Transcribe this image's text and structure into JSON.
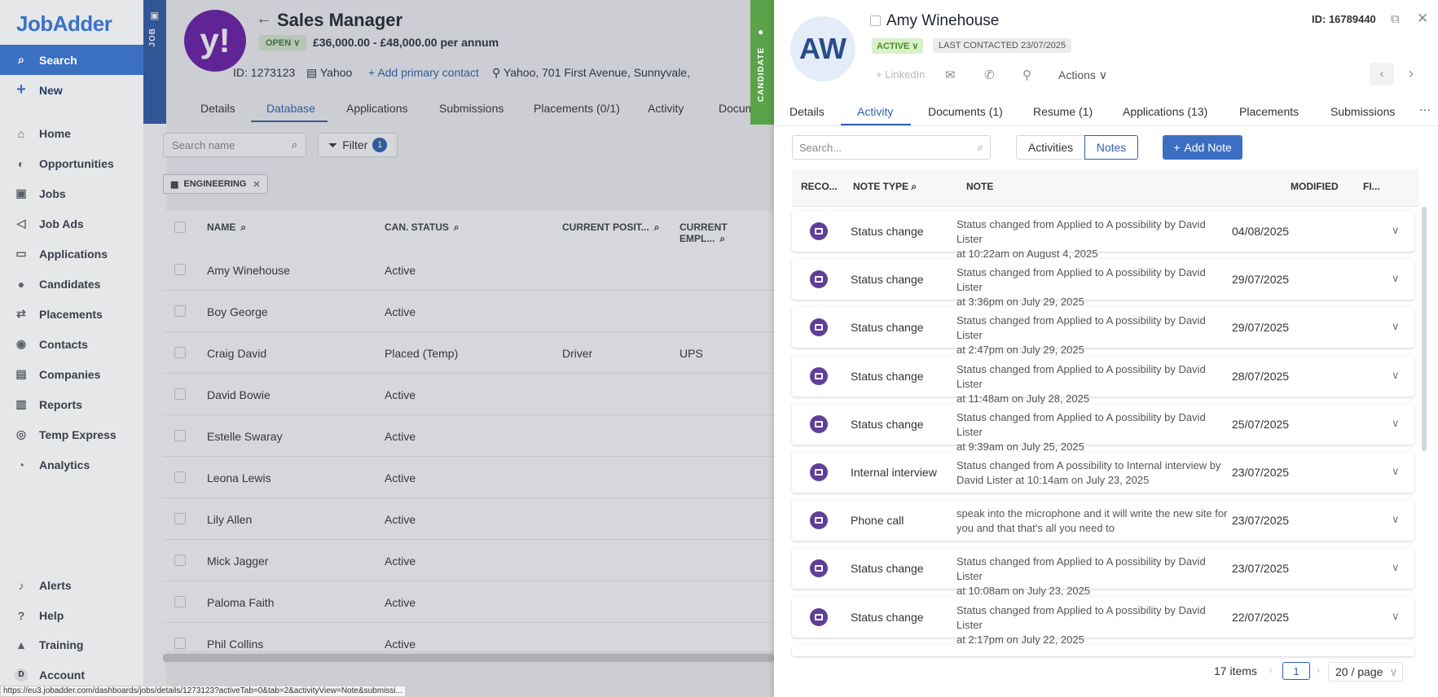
{
  "app": {
    "logo": "JobAdder"
  },
  "sidebar": {
    "items": [
      {
        "label": "Search",
        "icon": "search-icon"
      },
      {
        "label": "New",
        "icon": "plus-icon"
      },
      {
        "label": "Home",
        "icon": "home-icon"
      },
      {
        "label": "Opportunities",
        "icon": "opportunities-icon"
      },
      {
        "label": "Jobs",
        "icon": "briefcase-icon"
      },
      {
        "label": "Job Ads",
        "icon": "megaphone-icon"
      },
      {
        "label": "Applications",
        "icon": "applications-icon"
      },
      {
        "label": "Candidates",
        "icon": "person-icon"
      },
      {
        "label": "Placements",
        "icon": "placements-icon"
      },
      {
        "label": "Contacts",
        "icon": "contacts-icon"
      },
      {
        "label": "Companies",
        "icon": "building-icon"
      },
      {
        "label": "Reports",
        "icon": "reports-icon"
      },
      {
        "label": "Temp Express",
        "icon": "temp-express-icon"
      },
      {
        "label": "Analytics",
        "icon": "pie-chart-icon"
      }
    ],
    "bottom": [
      {
        "label": "Alerts",
        "icon": "bell-icon"
      },
      {
        "label": "Help",
        "icon": "help-icon"
      },
      {
        "label": "Training",
        "icon": "training-icon"
      },
      {
        "label": "Account",
        "icon": "account-icon",
        "avatar": "D"
      }
    ]
  },
  "job": {
    "strip_label": "JOB",
    "logo_text": "y!",
    "title": "Sales Manager",
    "status": "OPEN",
    "salary": "£36,000.00 - £48,000.00 per annum",
    "id": "ID: 1273123",
    "company": "Yahoo",
    "add_contact": "Add primary contact",
    "location": "Yahoo, 701 First Avenue, Sunnyvale,",
    "tabs": [
      "Details",
      "Database",
      "Applications",
      "Submissions",
      "Placements (0/1)",
      "Activity",
      "Docum"
    ],
    "search_placeholder": "Search name",
    "filter_label": "Filter",
    "filter_count": "1",
    "tag": "ENGINEERING",
    "columns": [
      "NAME",
      "CAN. STATUS",
      "CURRENT POSIT...",
      "CURRENT EMPL..."
    ],
    "rows": [
      {
        "name": "Amy Winehouse",
        "status": "Active",
        "position": "",
        "employer": ""
      },
      {
        "name": "Boy George",
        "status": "Active",
        "position": "",
        "employer": ""
      },
      {
        "name": "Craig David",
        "status": "Placed (Temp)",
        "position": "Driver",
        "employer": "UPS"
      },
      {
        "name": "David Bowie",
        "status": "Active",
        "position": "",
        "employer": ""
      },
      {
        "name": "Estelle Swaray",
        "status": "Active",
        "position": "",
        "employer": ""
      },
      {
        "name": "Leona Lewis",
        "status": "Active",
        "position": "",
        "employer": ""
      },
      {
        "name": "Lily Allen",
        "status": "Active",
        "position": "",
        "employer": ""
      },
      {
        "name": "Mick Jagger",
        "status": "Active",
        "position": "",
        "employer": ""
      },
      {
        "name": "Paloma Faith",
        "status": "Active",
        "position": "",
        "employer": ""
      },
      {
        "name": "Phil Collins",
        "status": "Active",
        "position": "",
        "employer": ""
      }
    ]
  },
  "status_url": "https://eu3.jobadder.com/dashboards/jobs/details/1273123?activeTab=0&tab=2&activityView=Note&submissi...",
  "candidate": {
    "strip_label": "CANDIDATE",
    "initials": "AW",
    "name": "Amy Winehouse",
    "status": "ACTIVE",
    "last_contacted": "LAST CONTACTED 23/07/2025",
    "id": "ID: 16789440",
    "linkedin": "LinkedIn",
    "actions": "Actions",
    "tabs": [
      "Details",
      "Activity",
      "Documents (1)",
      "Resume (1)",
      "Applications (13)",
      "Placements",
      "Submissions"
    ],
    "more": "···",
    "search_placeholder": "Search...",
    "toggle": [
      "Activities",
      "Notes"
    ],
    "add_note": "Add Note",
    "columns": [
      "RECO...",
      "NOTE TYPE",
      "NOTE",
      "MODIFIED",
      "FI..."
    ],
    "notes": [
      {
        "type": "Status change",
        "line1": "Status changed from Applied to A possibility by David Lister",
        "line2": "at 10:22am on August 4, 2025",
        "modified": "04/08/2025"
      },
      {
        "type": "Status change",
        "line1": "Status changed from Applied to A possibility by David Lister",
        "line2": "at 3:36pm on July 29, 2025",
        "modified": "29/07/2025"
      },
      {
        "type": "Status change",
        "line1": "Status changed from Applied to A possibility by David Lister",
        "line2": "at 2:47pm on July 29, 2025",
        "modified": "29/07/2025"
      },
      {
        "type": "Status change",
        "line1": "Status changed from Applied to A possibility by David Lister",
        "line2": "at 11:48am on July 28, 2025",
        "modified": "28/07/2025"
      },
      {
        "type": "Status change",
        "line1": "Status changed from Applied to A possibility by David Lister",
        "line2": "at 9:39am on July 25, 2025",
        "modified": "25/07/2025"
      },
      {
        "type": "Internal interview",
        "line1": "Status changed from A possibility to Internal interview by",
        "line2": "David Lister at 10:14am on July 23, 2025",
        "modified": "23/07/2025"
      },
      {
        "type": "Phone call",
        "line1": "speak into the microphone and it will write the new site for",
        "line2": "you and that that's all you need to",
        "modified": "23/07/2025"
      },
      {
        "type": "Status change",
        "line1": "Status changed from Applied to A possibility by David Lister",
        "line2": "at 10:08am on July 23, 2025",
        "modified": "23/07/2025"
      },
      {
        "type": "Status change",
        "line1": "Status changed from Applied to A possibility by David Lister",
        "line2": "at 2:17pm on July 22, 2025",
        "modified": "22/07/2025"
      }
    ],
    "footer": {
      "items": "17 items",
      "page": "1",
      "page_size": "20 / page"
    }
  },
  "colors": {
    "accent": "#3b6fc2",
    "candidate_green": "#5aa348",
    "note_icon": "#5e3f9a"
  }
}
